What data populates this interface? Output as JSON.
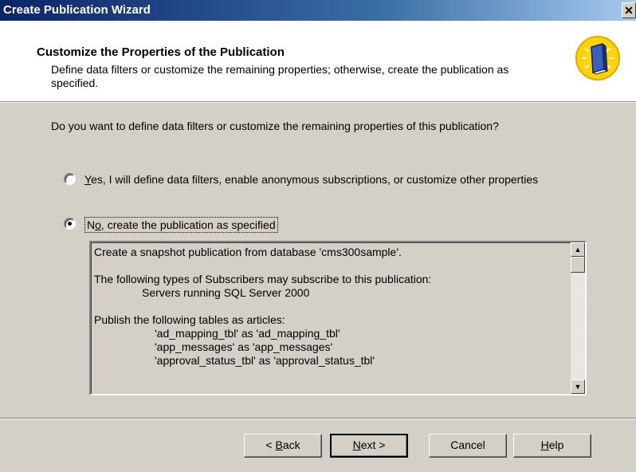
{
  "window": {
    "title": "Create Publication Wizard",
    "close_glyph": "✕"
  },
  "header": {
    "title": "Customize the Properties of the Publication",
    "description": "Define data filters or customize the remaining properties; otherwise, create the publication as specified.",
    "icon": "publication-book-icon"
  },
  "question": "Do you want to define data filters or customize the remaining properties of this publication?",
  "options": [
    {
      "label_accesskey": "Y",
      "label_rest": "es, I will define data filters, enable anonymous subscriptions, or customize other properties",
      "selected": false
    },
    {
      "label_accesskey": "o",
      "label_pre": "N",
      "label_rest": ", create the publication as specified",
      "selected": true
    }
  ],
  "summary": {
    "line1": "Create a snapshot publication from database 'cms300sample'.",
    "line2": "The following types of Subscribers may subscribe to this publication:",
    "line3": "Servers running SQL Server 2000",
    "line4": "Publish the following tables as articles:",
    "articles": [
      "'ad_mapping_tbl' as 'ad_mapping_tbl'",
      "'app_messages' as 'app_messages'",
      "'approval_status_tbl' as 'approval_status_tbl'"
    ],
    "scroll_up": "▲",
    "scroll_down": "▼"
  },
  "buttons": {
    "back_pre": "< ",
    "back_key": "B",
    "back_rest": "ack",
    "next_key": "N",
    "next_rest": "ext >",
    "cancel": "Cancel",
    "help_key": "H",
    "help_rest": "elp"
  }
}
